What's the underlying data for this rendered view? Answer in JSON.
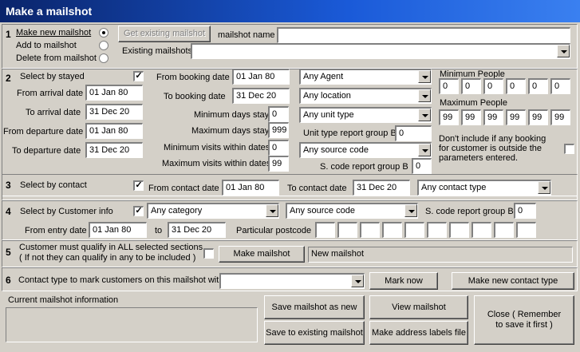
{
  "window": {
    "title": "Make a mailshot"
  },
  "s1": {
    "num": "1",
    "opt_new": "Make new mailshot",
    "opt_add": "Add to mailshot",
    "opt_delete": "Delete from mailshot",
    "get_existing_btn": "Get existing mailshot",
    "mailshot_name_label": "mailshot name",
    "mailshot_name_value": "",
    "existing_label": "Existing mailshots",
    "existing_value": ""
  },
  "s2": {
    "num": "2",
    "select_label": "Select by stayed",
    "checked": "✓",
    "from_arrival_label": "From arrival date",
    "from_arrival": "01 Jan 80",
    "to_arrival_label": "To arrival date",
    "to_arrival": "31 Dec 20",
    "from_departure_label": "From departure date",
    "from_departure": "01 Jan 80",
    "to_departure_label": "To departure date",
    "to_departure": "31 Dec 20",
    "from_booking_label": "From booking date",
    "from_booking": "01 Jan 80",
    "to_booking_label": "To booking date",
    "to_booking": "31 Dec 20",
    "min_days_label": "Minimum days stay",
    "min_days": "0",
    "max_days_label": "Maximum days stay",
    "max_days": "999",
    "min_visits_label": "Minimum visits within dates",
    "min_visits": "0",
    "max_visits_label": "Maximum visits within dates",
    "max_visits": "99",
    "agent": "Any Agent",
    "location": "Any location",
    "unit_type": "Any unit type",
    "unit_group_label": "Unit type report group B",
    "unit_group": "0",
    "source_code": "Any source code",
    "scode_group_label": "S. code report group B",
    "scode_group": "0",
    "min_people_label": "Minimum People",
    "min_people": [
      "0",
      "0",
      "0",
      "0",
      "0",
      "0"
    ],
    "max_people_label": "Maximum People",
    "max_people": [
      "99",
      "99",
      "99",
      "99",
      "99",
      "99"
    ],
    "dont_include_text": "Don't include if any booking for customer is outside the parameters entered."
  },
  "s3": {
    "num": "3",
    "select_label": "Select by contact",
    "checked": "✓",
    "from_contact_label": "From contact date",
    "from_contact": "01 Jan 80",
    "to_contact_label": "To contact date",
    "to_contact": "31 Dec 20",
    "contact_type": "Any contact type"
  },
  "s4": {
    "num": "4",
    "select_label": "Select by Customer info",
    "checked": "✓",
    "category": "Any category",
    "source_code": "Any source code",
    "scode_group_label": "S. code report group B",
    "scode_group": "0",
    "from_entry_label": "From entry date",
    "from_entry": "01 Jan 80",
    "to_label": "to",
    "to_entry": "31 Dec 20",
    "postcode_label": "Particular postcode",
    "postcode": [
      "",
      "",
      "",
      "",
      "",
      "",
      "",
      "",
      "",
      ""
    ]
  },
  "s5": {
    "num": "5",
    "qualify_line1": "Customer must qualify in ALL selected sections.",
    "qualify_line2": "( If not they can qualify in any to be included )",
    "make_btn": "Make mailshot",
    "status": "New mailshot"
  },
  "s6": {
    "num": "6",
    "contact_type_label": "Contact type to mark customers on this mailshot with",
    "contact_type_value": "",
    "mark_now_btn": "Mark now",
    "make_contact_type_btn": "Make new contact type"
  },
  "footer": {
    "current_info_label": "Current mailshot information",
    "save_new_btn": "Save mailshot as new",
    "save_existing_btn": "Save to existing mailshot",
    "view_btn": "View mailshot",
    "labels_btn": "Make address labels file",
    "close_btn": "Close ( Remember to save it first )"
  }
}
